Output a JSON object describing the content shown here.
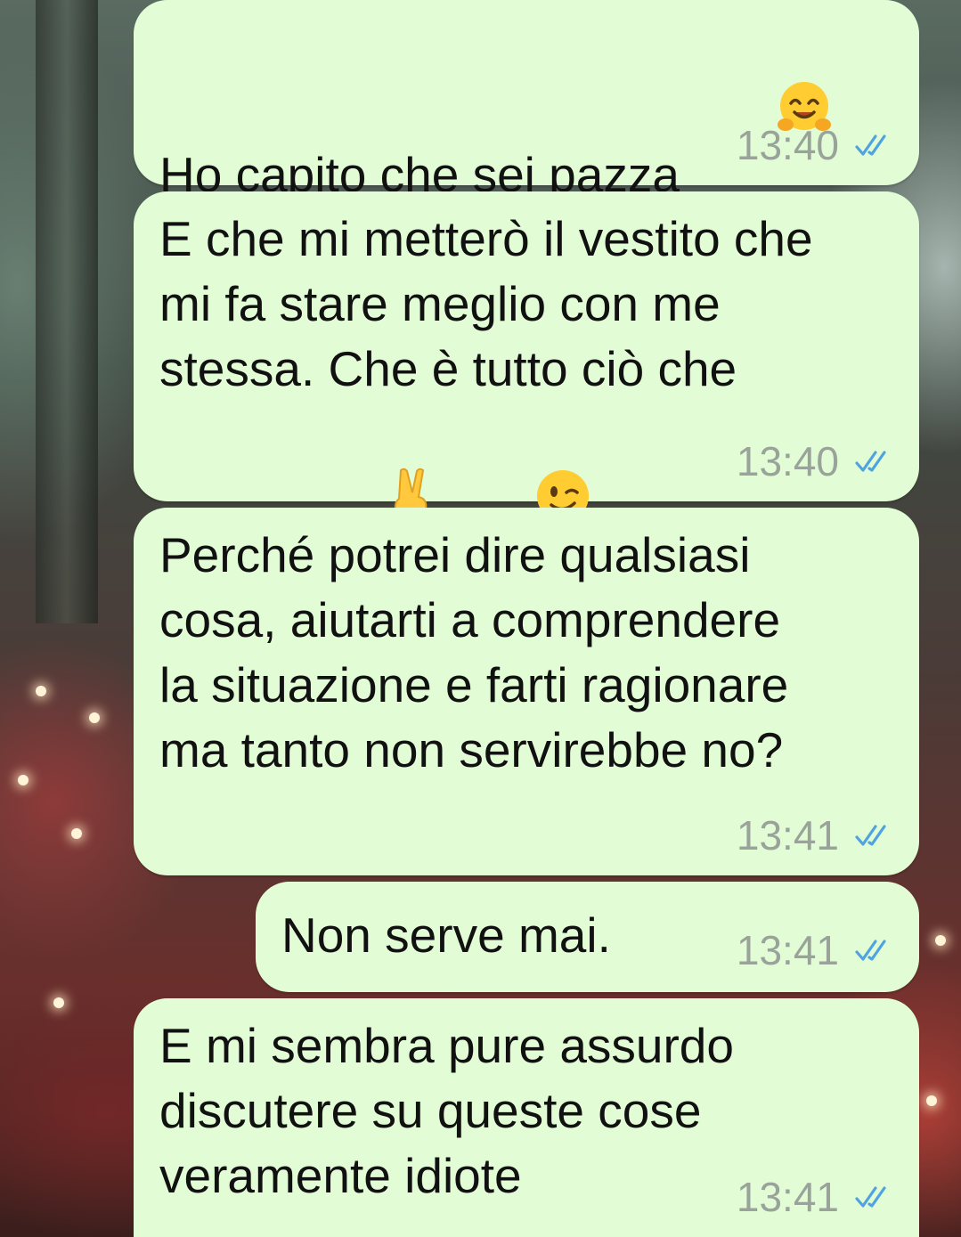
{
  "chat": {
    "messages": [
      {
        "id": "m1",
        "text": "Ho capito che sei pazza",
        "emojis": [
          "hugging-face"
        ],
        "time": "13:40",
        "status": "read",
        "direction": "outgoing"
      },
      {
        "id": "m2",
        "text": "E che mi metterò il vestito che\nmi fa stare meglio con me\nstessa. Che è tutto ciò che\nconta.",
        "emojis": [
          "victory-hand",
          "winking-face"
        ],
        "time": "13:40",
        "status": "read",
        "direction": "outgoing"
      },
      {
        "id": "m3",
        "text": "Perché potrei dire qualsiasi\ncosa, aiutarti a comprendere\nla situazione e farti ragionare\nma tanto non servirebbe no?",
        "emojis": [],
        "time": "13:41",
        "status": "read",
        "direction": "outgoing"
      },
      {
        "id": "m4",
        "text": "Non serve mai.",
        "emojis": [],
        "time": "13:41",
        "status": "read",
        "direction": "outgoing"
      },
      {
        "id": "m5",
        "text": "E mi sembra pure assurdo\ndiscutere su queste cose\nveramente idiote",
        "emojis": [],
        "time": "13:41",
        "status": "read",
        "direction": "outgoing"
      }
    ]
  },
  "colors": {
    "bubble_outgoing": "#e2fdd5",
    "time_text": "#9aa39a",
    "read_ticks": "#4fa3e0"
  }
}
